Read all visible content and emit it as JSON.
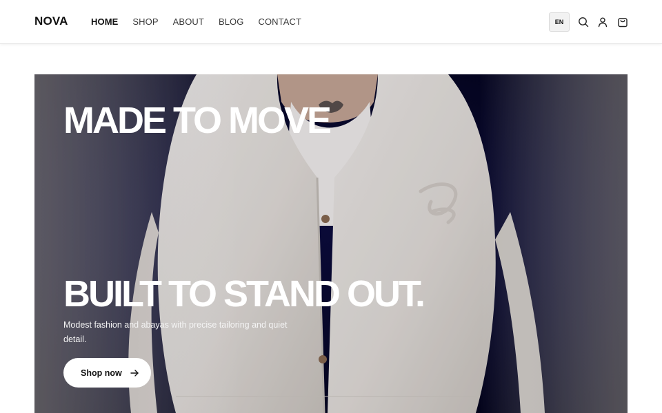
{
  "header": {
    "logo": "NOVA",
    "nav": [
      {
        "label": "HOME",
        "active": true
      },
      {
        "label": "SHOP",
        "active": false
      },
      {
        "label": "ABOUT",
        "active": false
      },
      {
        "label": "BLOG",
        "active": false
      },
      {
        "label": "CONTACT",
        "active": false
      }
    ],
    "language": "EN",
    "icons": [
      "search-icon",
      "user-icon",
      "cart-icon"
    ]
  },
  "hero": {
    "headline_top": "MADE TO MOVE",
    "headline_bottom": "BUILT TO STAND OUT.",
    "subtitle": "Modest fashion and abayas with precise tailoring and quiet detail.",
    "cta_label": "Shop now",
    "cta_icon": "arrow-right-icon",
    "background_color": "#030322",
    "garment_color": "#ece8e1"
  }
}
